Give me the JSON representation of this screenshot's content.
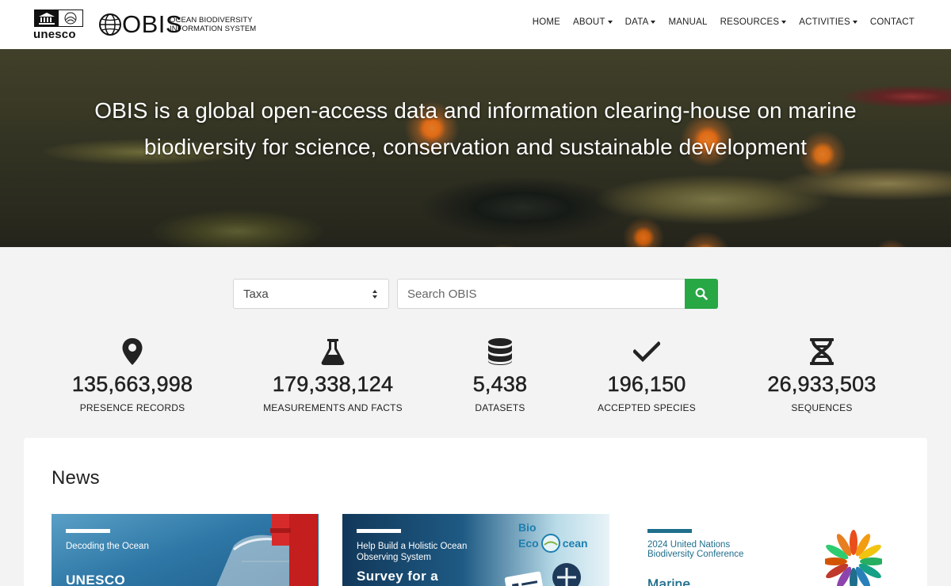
{
  "header": {
    "unesco_wordmark": "unesco",
    "obis_wordmark": "OBIS",
    "obis_subtitle_line1": "OCEAN BIODIVERSITY",
    "obis_subtitle_line2": "INFORMATION SYSTEM",
    "nav": [
      {
        "label": "HOME",
        "has_dropdown": false
      },
      {
        "label": "ABOUT",
        "has_dropdown": true
      },
      {
        "label": "DATA",
        "has_dropdown": true
      },
      {
        "label": "MANUAL",
        "has_dropdown": false
      },
      {
        "label": "RESOURCES",
        "has_dropdown": true
      },
      {
        "label": "ACTIVITIES",
        "has_dropdown": true
      },
      {
        "label": "CONTACT",
        "has_dropdown": false
      }
    ]
  },
  "hero": {
    "tagline": "OBIS is a global open-access data and information clearing-house on marine biodiversity for science, conservation and sustainable development"
  },
  "search": {
    "select_value": "Taxa",
    "placeholder": "Search OBIS",
    "button_icon": "search-icon",
    "button_color": "#28a745"
  },
  "stats": [
    {
      "icon": "map-marker-icon",
      "value": "135,663,998",
      "label": "PRESENCE RECORDS"
    },
    {
      "icon": "flask-icon",
      "value": "179,338,124",
      "label": "MEASUREMENTS AND FACTS"
    },
    {
      "icon": "database-icon",
      "value": "5,438",
      "label": "DATASETS"
    },
    {
      "icon": "check-icon",
      "value": "196,150",
      "label": "ACCEPTED SPECIES"
    },
    {
      "icon": "dna-icon",
      "value": "26,933,503",
      "label": "SEQUENCES"
    }
  ],
  "news": {
    "title": "News",
    "items": [
      {
        "kicker": "Decoding the Ocean",
        "headline": "UNESCO"
      },
      {
        "kicker": "Help Build a Holistic Ocean Observing System",
        "headline": "Survey for a",
        "logo_line1": "Bio",
        "logo_line2": "Eco",
        "logo_line3": "cean"
      },
      {
        "kicker": "2024 United Nations Biodiversity Conference",
        "headline": "Marine"
      }
    ]
  },
  "colors": {
    "accent_green": "#28a745",
    "news_teal": "#1f6e8c"
  }
}
